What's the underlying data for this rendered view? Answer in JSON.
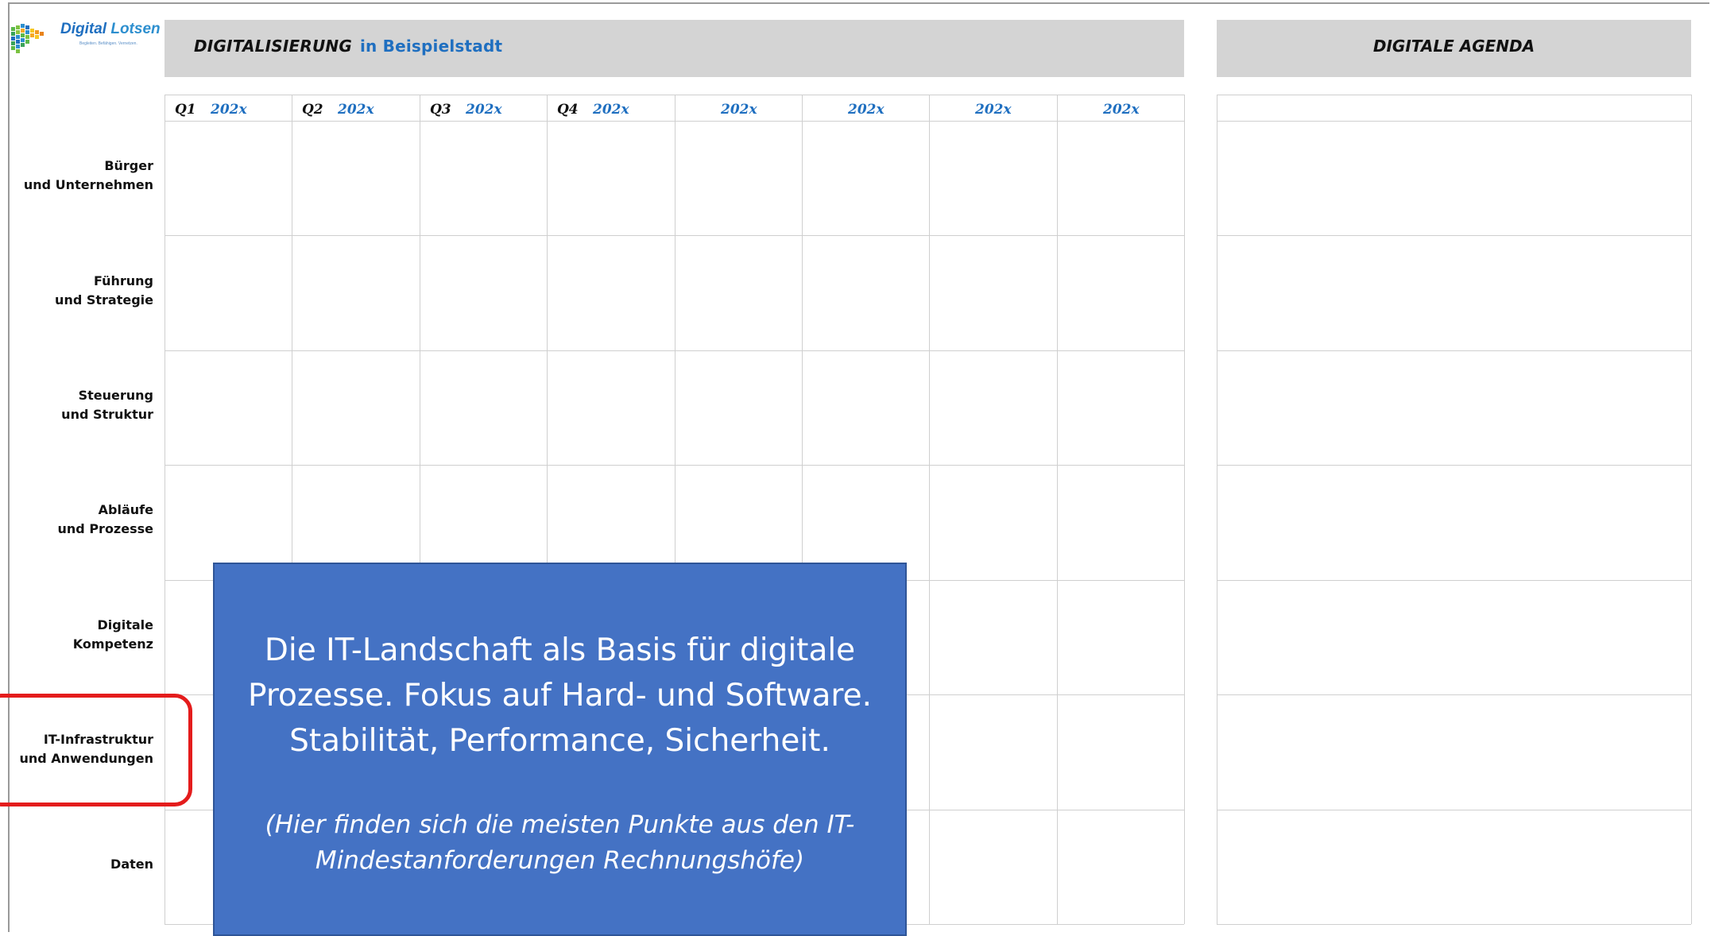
{
  "logo": {
    "brand_first": "Digital",
    "brand_second": "Lotsen",
    "tagline": "Begleiten. Befähigen. Vernetzen."
  },
  "header": {
    "title": "DIGITALISIERUNG",
    "subtitle": "in Beispielstadt",
    "right_title": "DIGITALE AGENDA"
  },
  "columns": [
    {
      "quarter": "Q1",
      "year": "202x"
    },
    {
      "quarter": "Q2",
      "year": "202x"
    },
    {
      "quarter": "Q3",
      "year": "202x"
    },
    {
      "quarter": "Q4",
      "year": "202x"
    },
    {
      "quarter": "",
      "year": "202x"
    },
    {
      "quarter": "",
      "year": "202x"
    },
    {
      "quarter": "",
      "year": "202x"
    },
    {
      "quarter": "",
      "year": "202x"
    }
  ],
  "rows": [
    {
      "line1": "Bürger",
      "line2": "und Unternehmen"
    },
    {
      "line1": "Führung",
      "line2": "und Strategie"
    },
    {
      "line1": "Steuerung",
      "line2": "und Struktur"
    },
    {
      "line1": "Abläufe",
      "line2": "und Prozesse"
    },
    {
      "line1": "Digitale",
      "line2": "Kompetenz"
    },
    {
      "line1": "IT-Infrastruktur",
      "line2": "und Anwendungen"
    },
    {
      "line1": "Daten",
      "line2": ""
    }
  ],
  "highlighted_row": "IT-Infrastruktur und Anwendungen",
  "callout": {
    "line1": "Die IT-Landschaft als Basis für digitale",
    "line2": "Prozesse. Fokus auf Hard- und Software.",
    "line3": "Stabilität, Performance, Sicherheit.",
    "note1": "(Hier finden sich die meisten Punkte aus den IT-",
    "note2": "Mindestanforderungen Rechnungshöfe)"
  },
  "colors": {
    "callout_bg": "#4472c4",
    "highlight_border": "#e41c1c",
    "accent_blue": "#1f6fc0",
    "header_bar": "#d4d4d4"
  }
}
